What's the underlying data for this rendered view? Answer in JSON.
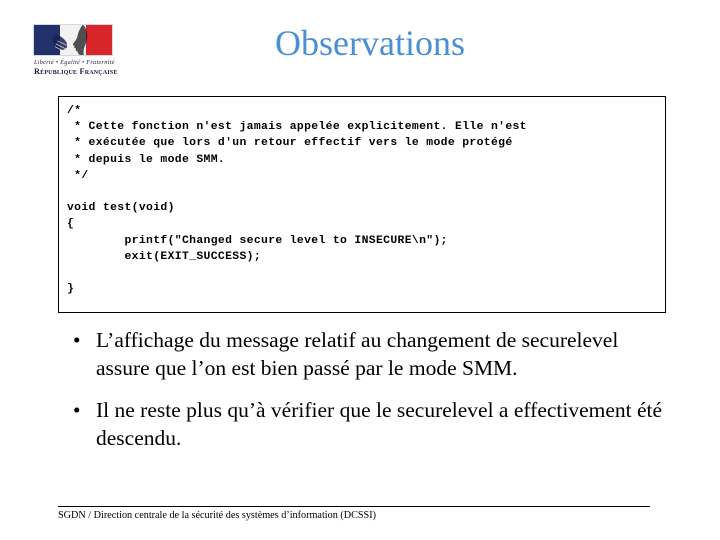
{
  "slide": {
    "title": "Observations",
    "title_color": "#4a8fd4"
  },
  "logo": {
    "name": "republique-francaise-logo",
    "motto": "Liberté • Égalité • Fraternité",
    "institution": "République Française",
    "flag_colors": {
      "blue": "#22306b",
      "white": "#f2f2f2",
      "red": "#d8242b"
    }
  },
  "code_box": {
    "language": "c",
    "lines": [
      "/*",
      " * Cette fonction n'est jamais appelée explicitement. Elle n'est",
      " * exécutée que lors d'un retour effectif vers le mode protégé",
      " * depuis le mode SMM.",
      " */",
      "",
      "void test(void)",
      "{",
      "        printf(\"Changed secure level to INSECURE\\n\");",
      "        exit(EXIT_SUCCESS);",
      "",
      "}"
    ],
    "text": "/*\n * Cette fonction n'est jamais appelée explicitement. Elle n'est\n * exécutée que lors d'un retour effectif vers le mode protégé\n * depuis le mode SMM.\n */\n\nvoid test(void)\n{\n        printf(\"Changed secure level to INSECURE\\n\");\n        exit(EXIT_SUCCESS);\n\n}"
  },
  "bullets": {
    "marker": "•",
    "items": [
      {
        "text": "L’affichage du message relatif au changement de securelevel assure que l’on est bien passé par le mode SMM."
      },
      {
        "text": "Il ne reste plus qu’à vérifier que le securelevel a effectivement été descendu."
      }
    ]
  },
  "footer": {
    "text": "SGDN / Direction centrale de la sécurité des systèmes d’information (DCSSI)"
  }
}
